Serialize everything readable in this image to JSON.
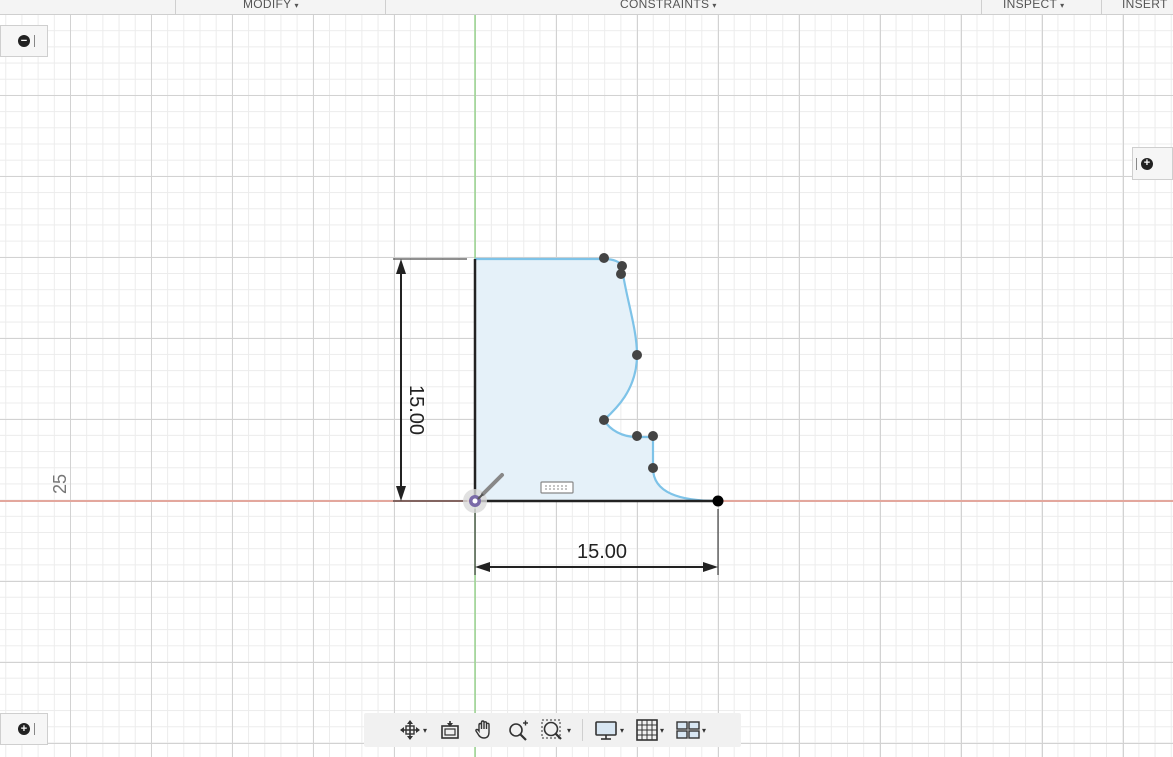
{
  "toolbar": {
    "groups": [
      {
        "label": "MODIFY"
      },
      {
        "label": "CONSTRAINTS"
      },
      {
        "label": "INSPECT"
      },
      {
        "label": "INSERT"
      }
    ]
  },
  "viewport": {
    "axis_label": "25",
    "dim_vertical": "15.00",
    "dim_horizontal": "15.00"
  },
  "colors": {
    "profile_fill": "#e5f1f9",
    "spline": "#7ec3e8",
    "x_axis": "#e3a79d",
    "y_axis": "#9ad58f"
  },
  "nav": {
    "icons": [
      "orbit-icon",
      "look-at-icon",
      "pan-icon",
      "zoom-icon",
      "fit-icon",
      "display-settings-icon",
      "grid-settings-icon",
      "viewports-icon"
    ]
  },
  "panels": {
    "browser_toggle": "collapse",
    "comments_toggle": "expand",
    "sketch_palette_toggle": "expand"
  }
}
